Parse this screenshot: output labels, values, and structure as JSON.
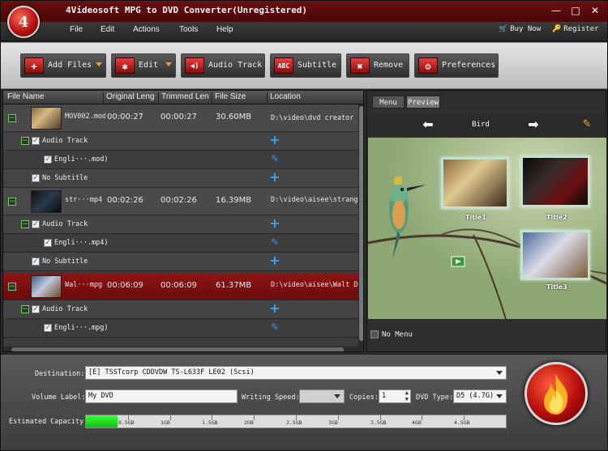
{
  "app": {
    "title": "4Videosoft MPG to DVD Converter(Unregistered)",
    "logo_text": "4",
    "window_controls": {
      "minimize": "—",
      "restore": "□",
      "close": "✕"
    }
  },
  "menu": {
    "items": [
      "File",
      "Edit",
      "Actions",
      "Tools",
      "Help"
    ],
    "buy_now": "Buy Now",
    "register": "Register"
  },
  "toolbar": {
    "add_files": "Add Files",
    "edit": "Edit",
    "audio_track": "Audio Track",
    "subtitle": "Subtitle",
    "remove": "Remove",
    "preferences": "Preferences",
    "icons": {
      "add_files": "+",
      "edit": "✱",
      "audio_track": "◀)",
      "subtitle": "ABC",
      "remove": "✖",
      "preferences": "⚙"
    }
  },
  "file_list": {
    "columns": [
      "File Name",
      "Original Leng",
      "Trimmed Len",
      "File Size",
      "Location"
    ],
    "files": [
      {
        "name": "MOV002.mod",
        "original": "00:00:27",
        "trimmed": "00:00:27",
        "size": "30.60MB",
        "location": "D:\\video\\dvd creator 子",
        "audio_label": "Audio Track",
        "audio_item": "Engli···.mod)",
        "subtitle_label": "No Subtitle"
      },
      {
        "name": "str···mp4",
        "original": "00:02:26",
        "trimmed": "00:02:26",
        "size": "16.39MB",
        "location": "D:\\video\\aisee\\strange",
        "audio_label": "Audio Track",
        "audio_item": "Engli···.mp4)",
        "subtitle_label": "No Subtitle"
      },
      {
        "name": "Wal···mpg",
        "original": "00:06:09",
        "trimmed": "00:06:09",
        "size": "61.37MB",
        "location": "D:\\video\\aisee\\Walt Di",
        "audio_label": "Audio Track",
        "audio_item": "Engli···.mpg)"
      }
    ]
  },
  "preview": {
    "tab_menu": "Menu",
    "tab_preview": "Preview",
    "menu_title": "Bird",
    "titles": [
      "Title1",
      "Title2",
      "Title3"
    ],
    "no_menu": "No Menu"
  },
  "bottom": {
    "destination_label": "Destination:",
    "destination_value": "[E] TSSTcorp CDDVDW TS-L633F LE02 (Scsi)",
    "volume_label": "Volume Label:",
    "volume_value": "My DVD",
    "writing_speed_label": "Writing Speed:",
    "writing_speed_value": "",
    "copies_label": "Copies:",
    "copies_value": "1",
    "dvd_type_label": "DVD Type:",
    "dvd_type_value": "D5 (4.7G)",
    "capacity_label": "Estimated Capacity:",
    "capacity_ticks": [
      "0.5GB",
      "1GB",
      "1.5GB",
      "2GB",
      "2.5GB",
      "3GB",
      "3.5GB",
      "4GB",
      "4.5GB"
    ],
    "capacity_used_fraction": 0.075
  }
}
